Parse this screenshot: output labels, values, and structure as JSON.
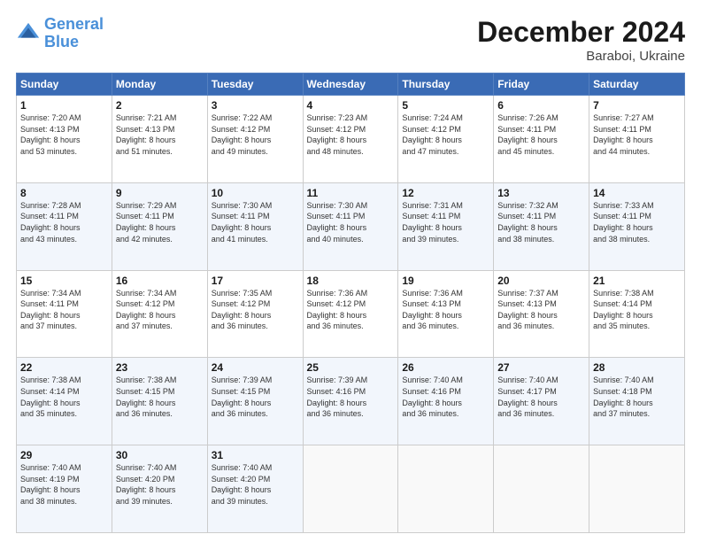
{
  "logo": {
    "line1": "General",
    "line2": "Blue"
  },
  "title": "December 2024",
  "subtitle": "Baraboi, Ukraine",
  "days_header": [
    "Sunday",
    "Monday",
    "Tuesday",
    "Wednesday",
    "Thursday",
    "Friday",
    "Saturday"
  ],
  "weeks": [
    [
      {
        "num": "1",
        "info": "Sunrise: 7:20 AM\nSunset: 4:13 PM\nDaylight: 8 hours\nand 53 minutes."
      },
      {
        "num": "2",
        "info": "Sunrise: 7:21 AM\nSunset: 4:13 PM\nDaylight: 8 hours\nand 51 minutes."
      },
      {
        "num": "3",
        "info": "Sunrise: 7:22 AM\nSunset: 4:12 PM\nDaylight: 8 hours\nand 49 minutes."
      },
      {
        "num": "4",
        "info": "Sunrise: 7:23 AM\nSunset: 4:12 PM\nDaylight: 8 hours\nand 48 minutes."
      },
      {
        "num": "5",
        "info": "Sunrise: 7:24 AM\nSunset: 4:12 PM\nDaylight: 8 hours\nand 47 minutes."
      },
      {
        "num": "6",
        "info": "Sunrise: 7:26 AM\nSunset: 4:11 PM\nDaylight: 8 hours\nand 45 minutes."
      },
      {
        "num": "7",
        "info": "Sunrise: 7:27 AM\nSunset: 4:11 PM\nDaylight: 8 hours\nand 44 minutes."
      }
    ],
    [
      {
        "num": "8",
        "info": "Sunrise: 7:28 AM\nSunset: 4:11 PM\nDaylight: 8 hours\nand 43 minutes."
      },
      {
        "num": "9",
        "info": "Sunrise: 7:29 AM\nSunset: 4:11 PM\nDaylight: 8 hours\nand 42 minutes."
      },
      {
        "num": "10",
        "info": "Sunrise: 7:30 AM\nSunset: 4:11 PM\nDaylight: 8 hours\nand 41 minutes."
      },
      {
        "num": "11",
        "info": "Sunrise: 7:30 AM\nSunset: 4:11 PM\nDaylight: 8 hours\nand 40 minutes."
      },
      {
        "num": "12",
        "info": "Sunrise: 7:31 AM\nSunset: 4:11 PM\nDaylight: 8 hours\nand 39 minutes."
      },
      {
        "num": "13",
        "info": "Sunrise: 7:32 AM\nSunset: 4:11 PM\nDaylight: 8 hours\nand 38 minutes."
      },
      {
        "num": "14",
        "info": "Sunrise: 7:33 AM\nSunset: 4:11 PM\nDaylight: 8 hours\nand 38 minutes."
      }
    ],
    [
      {
        "num": "15",
        "info": "Sunrise: 7:34 AM\nSunset: 4:11 PM\nDaylight: 8 hours\nand 37 minutes."
      },
      {
        "num": "16",
        "info": "Sunrise: 7:34 AM\nSunset: 4:12 PM\nDaylight: 8 hours\nand 37 minutes."
      },
      {
        "num": "17",
        "info": "Sunrise: 7:35 AM\nSunset: 4:12 PM\nDaylight: 8 hours\nand 36 minutes."
      },
      {
        "num": "18",
        "info": "Sunrise: 7:36 AM\nSunset: 4:12 PM\nDaylight: 8 hours\nand 36 minutes."
      },
      {
        "num": "19",
        "info": "Sunrise: 7:36 AM\nSunset: 4:13 PM\nDaylight: 8 hours\nand 36 minutes."
      },
      {
        "num": "20",
        "info": "Sunrise: 7:37 AM\nSunset: 4:13 PM\nDaylight: 8 hours\nand 36 minutes."
      },
      {
        "num": "21",
        "info": "Sunrise: 7:38 AM\nSunset: 4:14 PM\nDaylight: 8 hours\nand 35 minutes."
      }
    ],
    [
      {
        "num": "22",
        "info": "Sunrise: 7:38 AM\nSunset: 4:14 PM\nDaylight: 8 hours\nand 35 minutes."
      },
      {
        "num": "23",
        "info": "Sunrise: 7:38 AM\nSunset: 4:15 PM\nDaylight: 8 hours\nand 36 minutes."
      },
      {
        "num": "24",
        "info": "Sunrise: 7:39 AM\nSunset: 4:15 PM\nDaylight: 8 hours\nand 36 minutes."
      },
      {
        "num": "25",
        "info": "Sunrise: 7:39 AM\nSunset: 4:16 PM\nDaylight: 8 hours\nand 36 minutes."
      },
      {
        "num": "26",
        "info": "Sunrise: 7:40 AM\nSunset: 4:16 PM\nDaylight: 8 hours\nand 36 minutes."
      },
      {
        "num": "27",
        "info": "Sunrise: 7:40 AM\nSunset: 4:17 PM\nDaylight: 8 hours\nand 36 minutes."
      },
      {
        "num": "28",
        "info": "Sunrise: 7:40 AM\nSunset: 4:18 PM\nDaylight: 8 hours\nand 37 minutes."
      }
    ],
    [
      {
        "num": "29",
        "info": "Sunrise: 7:40 AM\nSunset: 4:19 PM\nDaylight: 8 hours\nand 38 minutes."
      },
      {
        "num": "30",
        "info": "Sunrise: 7:40 AM\nSunset: 4:20 PM\nDaylight: 8 hours\nand 39 minutes."
      },
      {
        "num": "31",
        "info": "Sunrise: 7:40 AM\nSunset: 4:20 PM\nDaylight: 8 hours\nand 39 minutes."
      },
      {
        "num": "",
        "info": ""
      },
      {
        "num": "",
        "info": ""
      },
      {
        "num": "",
        "info": ""
      },
      {
        "num": "",
        "info": ""
      }
    ]
  ]
}
